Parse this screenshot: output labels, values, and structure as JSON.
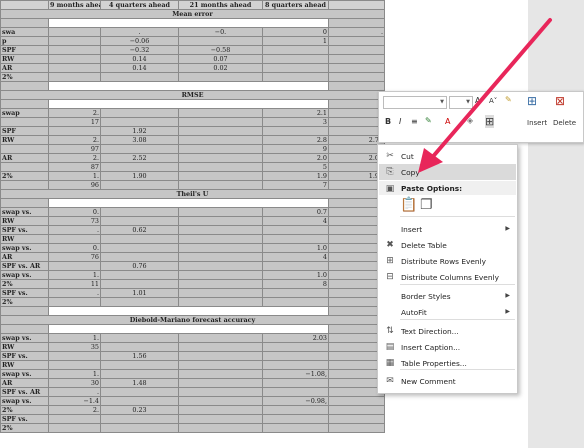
{
  "table": {
    "header": [
      "",
      "9 months ahead",
      "4 quarters ahead",
      "21 months ahead",
      "8 quarters ahead",
      ""
    ],
    "rows": [
      {
        "type": "sec",
        "text": "Mean error"
      },
      {
        "type": "blank"
      },
      {
        "type": "data",
        "cells": [
          "swa",
          "",
          ".",
          "−0.",
          "0",
          "."
        ]
      },
      {
        "type": "data",
        "cells": [
          "p",
          "",
          "−0.06",
          "",
          "1",
          ""
        ]
      },
      {
        "type": "data",
        "cells": [
          "SPF",
          "",
          "−0.32",
          "−0.58",
          "",
          ""
        ]
      },
      {
        "type": "data",
        "cells": [
          "RW",
          "",
          "0.14",
          "0.07",
          "",
          ""
        ]
      },
      {
        "type": "data",
        "cells": [
          "AR",
          "",
          "0.14",
          "0.02",
          "",
          ""
        ]
      },
      {
        "type": "data",
        "cells": [
          "2%",
          "",
          "",
          "",
          "",
          ""
        ]
      },
      {
        "type": "blank"
      },
      {
        "type": "sec",
        "text": "RMSE"
      },
      {
        "type": "blank"
      },
      {
        "type": "data",
        "cells": [
          "swap",
          "2.",
          "",
          "",
          "2.1",
          ""
        ]
      },
      {
        "type": "data",
        "cells": [
          "",
          "17",
          "",
          "",
          "3",
          ""
        ]
      },
      {
        "type": "data",
        "cells": [
          "SPF",
          "",
          "1.92",
          "",
          "",
          ""
        ]
      },
      {
        "type": "data",
        "cells": [
          "RW",
          "2.",
          "3.08",
          "",
          "2.8",
          "2.73"
        ]
      },
      {
        "type": "data",
        "cells": [
          "",
          "97",
          "",
          "",
          "9",
          ""
        ]
      },
      {
        "type": "data",
        "cells": [
          "AR",
          "2.",
          "2.52",
          "",
          "2.0",
          "2.05"
        ]
      },
      {
        "type": "data",
        "cells": [
          "",
          "87",
          "",
          "",
          "5",
          ""
        ]
      },
      {
        "type": "data",
        "cells": [
          "2%",
          "1.",
          "1.90",
          "",
          "1.9",
          "1.94"
        ]
      },
      {
        "type": "data",
        "cells": [
          "",
          "96",
          "",
          "",
          "7",
          ""
        ]
      },
      {
        "type": "sec",
        "text": "Theil's U"
      },
      {
        "type": "blank"
      },
      {
        "type": "data",
        "cells": [
          "swap vs.",
          "0.",
          "",
          "",
          "0.7",
          ""
        ]
      },
      {
        "type": "data",
        "cells": [
          "RW",
          "73",
          "",
          "",
          "4",
          ""
        ]
      },
      {
        "type": "data",
        "cells": [
          "SPF vs.",
          ".",
          "0.62",
          "",
          "",
          ""
        ]
      },
      {
        "type": "data",
        "cells": [
          "RW",
          "",
          "",
          "",
          "",
          ""
        ]
      },
      {
        "type": "data",
        "cells": [
          "swap vs.",
          "0.",
          "",
          "",
          "1.0",
          ""
        ]
      },
      {
        "type": "data",
        "cells": [
          "AR",
          "76",
          "",
          "",
          "4",
          ""
        ]
      },
      {
        "type": "data",
        "cells": [
          "SPF vs. AR",
          "",
          "0.76",
          "",
          "",
          ""
        ]
      },
      {
        "type": "data",
        "cells": [
          "swap vs.",
          "1.",
          "",
          "",
          "1.0",
          ""
        ]
      },
      {
        "type": "data",
        "cells": [
          "2%",
          "11",
          "",
          "",
          "8",
          ""
        ]
      },
      {
        "type": "data",
        "cells": [
          "SPF vs.",
          ".",
          "1.01",
          "",
          "",
          ""
        ]
      },
      {
        "type": "data",
        "cells": [
          "2%",
          "",
          "",
          "",
          "",
          ""
        ]
      },
      {
        "type": "blank"
      },
      {
        "type": "sec",
        "text": "Diebold-Mariano forecast accuracy"
      },
      {
        "type": "blank"
      },
      {
        "type": "data",
        "cells": [
          "swap vs.",
          "1.",
          "",
          "",
          "2.03",
          ""
        ]
      },
      {
        "type": "data",
        "cells": [
          "RW",
          "35",
          "",
          "",
          "",
          ""
        ]
      },
      {
        "type": "data",
        "cells": [
          "SPF vs.",
          "",
          "1.56",
          "",
          "",
          ""
        ]
      },
      {
        "type": "data",
        "cells": [
          "RW",
          "",
          "",
          "",
          "",
          ""
        ]
      },
      {
        "type": "data",
        "cells": [
          "swap vs.",
          "1.",
          "",
          "",
          "−1.08,",
          ""
        ]
      },
      {
        "type": "data",
        "cells": [
          "AR",
          "30",
          "1.48",
          "",
          "",
          ""
        ]
      },
      {
        "type": "data",
        "cells": [
          "SPF vs. AR",
          ".",
          "",
          "",
          "",
          ""
        ]
      },
      {
        "type": "data",
        "cells": [
          "swap vs.",
          "−1.4",
          "",
          "",
          "−0.98,",
          ""
        ]
      },
      {
        "type": "data",
        "cells": [
          "2%",
          "2.",
          "0.23",
          "",
          "",
          ""
        ]
      },
      {
        "type": "data",
        "cells": [
          "SPF vs.",
          "",
          "",
          "",
          "",
          ""
        ]
      },
      {
        "type": "data",
        "cells": [
          "2%",
          "",
          "",
          "",
          "",
          ""
        ]
      }
    ]
  },
  "mini_toolbar": {
    "font_size_letters": "A",
    "grow_font": "A˄",
    "shrink_font": "A˅",
    "bold": "B",
    "italic": "I",
    "align": "≡",
    "insert_label": "Insert",
    "delete_label": "Delete"
  },
  "context_menu": {
    "items": [
      {
        "label": "Cut",
        "icon": "scissors-icon",
        "glyph": "✂",
        "arrow": false
      },
      {
        "label": "Copy",
        "icon": "copy-icon",
        "glyph": "⎘",
        "arrow": false,
        "highlighted": true
      },
      {
        "label": "Paste Options:",
        "icon": "clipboard-icon",
        "glyph": "▣",
        "header": true
      },
      {
        "label": "Insert",
        "icon": "",
        "glyph": "",
        "arrow": true
      },
      {
        "label": "Delete Table",
        "icon": "delete-table-icon",
        "glyph": "✖",
        "arrow": false
      },
      {
        "label": "Distribute Rows Evenly",
        "icon": "distribute-rows-icon",
        "glyph": "⊞",
        "arrow": false
      },
      {
        "label": "Distribute Columns Evenly",
        "icon": "distribute-columns-icon",
        "glyph": "⊟",
        "arrow": false
      },
      {
        "label": "Border Styles",
        "icon": "",
        "glyph": "",
        "arrow": true
      },
      {
        "label": "AutoFit",
        "icon": "",
        "glyph": "",
        "arrow": true
      },
      {
        "label": "Text Direction...",
        "icon": "text-direction-icon",
        "glyph": "⇅",
        "arrow": false
      },
      {
        "label": "Insert Caption...",
        "icon": "insert-caption-icon",
        "glyph": "▤",
        "arrow": false
      },
      {
        "label": "Table Properties...",
        "icon": "table-properties-icon",
        "glyph": "▦",
        "arrow": false
      },
      {
        "label": "New Comment",
        "icon": "new-comment-icon",
        "glyph": "✉",
        "arrow": false
      }
    ]
  },
  "colors": {
    "selection": "#c6c6c6",
    "menu_highlight": "#dadada",
    "arrow": "#e8265a",
    "workspace": "#e6e6e6"
  }
}
